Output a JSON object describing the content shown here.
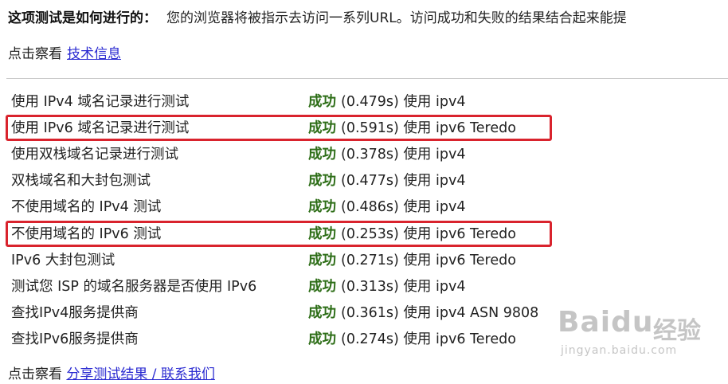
{
  "intro": {
    "heading": "这项测试是如何进行的：",
    "description": "您的浏览器将被指示去访问一系列URL。访问成功和失败的结果结合起来能提"
  },
  "detail": {
    "prefix": "点击察看",
    "link": "技术信息"
  },
  "tests": [
    {
      "name": "使用 IPv4 域名记录进行测试",
      "status": "成功",
      "detail": "(0.479s) 使用 ipv4"
    },
    {
      "name": "使用 IPv6 域名记录进行测试",
      "status": "成功",
      "detail": "(0.591s) 使用 ipv6 Teredo"
    },
    {
      "name": "使用双栈域名记录进行测试",
      "status": "成功",
      "detail": "(0.378s) 使用 ipv4"
    },
    {
      "name": "双栈域名和大封包测试",
      "status": "成功",
      "detail": "(0.477s) 使用 ipv4"
    },
    {
      "name": "不使用域名的 IPv4 测试",
      "status": "成功",
      "detail": "(0.486s) 使用 ipv4"
    },
    {
      "name": "不使用域名的 IPv6 测试",
      "status": "成功",
      "detail": "(0.253s) 使用 ipv6 Teredo"
    },
    {
      "name": "IPv6 大封包测试",
      "status": "成功",
      "detail": "(0.271s) 使用 ipv6 Teredo"
    },
    {
      "name": "测试您 ISP 的域名服务器是否使用 IPv6",
      "status": "成功",
      "detail": "(0.313s) 使用 ipv4"
    },
    {
      "name": "查找IPv4服务提供商",
      "status": "成功",
      "detail": "(0.361s) 使用 ipv4 ASN 9808"
    },
    {
      "name": "查找IPv6服务提供商",
      "status": "成功",
      "detail": "(0.274s) 使用 ipv6 Teredo"
    }
  ],
  "footer": {
    "prefix": "点击察看",
    "link": "分享测试结果 / 联系我们"
  },
  "watermark": {
    "brand": "Baidu",
    "cn": "经验",
    "sub": "jingyan.baidu.com"
  },
  "colors": {
    "success": "#2e6e18",
    "link": "#2b2bd1",
    "highlight_box": "#d9232d"
  }
}
